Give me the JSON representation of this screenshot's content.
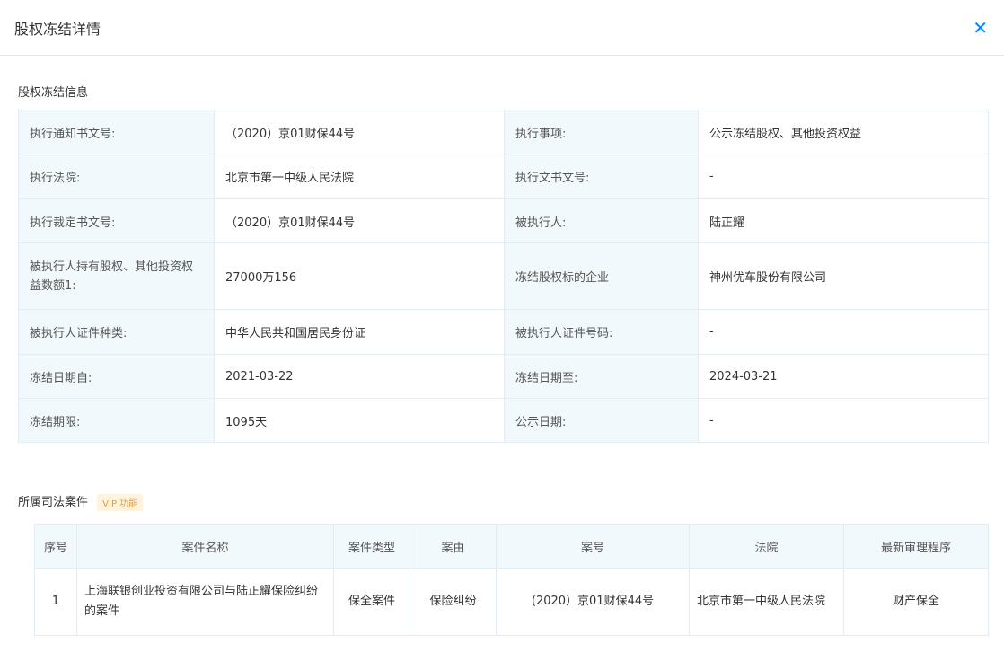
{
  "dialog": {
    "title": "股权冻结详情"
  },
  "info_section": {
    "title": "股权冻结信息",
    "rows": [
      {
        "l1": "执行通知书文号:",
        "v1": "（2020）京01财保44号",
        "l2": "执行事项:",
        "v2": "公示冻结股权、其他投资权益"
      },
      {
        "l1": "执行法院:",
        "v1": "北京市第一中级人民法院",
        "l2": "执行文书文号:",
        "v2": "-"
      },
      {
        "l1": "执行裁定书文号:",
        "v1": "（2020）京01财保44号",
        "l2": "被执行人:",
        "v2": "陆正耀"
      },
      {
        "l1": "被执行人持有股权、其他投资权益数额1:",
        "v1": "27000万156",
        "l2": "冻结股权标的企业",
        "v2": "神州优车股份有限公司"
      },
      {
        "l1": "被执行人证件种类:",
        "v1": "中华人民共和国居民身份证",
        "l2": "被执行人证件号码:",
        "v2": "-"
      },
      {
        "l1": "冻结日期自:",
        "v1": "2021-03-22",
        "l2": "冻结日期至:",
        "v2": "2024-03-21"
      },
      {
        "l1": "冻结期限:",
        "v1": "1095天",
        "l2": "公示日期:",
        "v2": "-"
      }
    ]
  },
  "case_section": {
    "title": "所属司法案件",
    "vip_badge": "VIP 功能",
    "columns": [
      "序号",
      "案件名称",
      "案件类型",
      "案由",
      "案号",
      "法院",
      "最新审理程序"
    ],
    "rows": [
      {
        "index": "1",
        "name": "上海联银创业投资有限公司与陆正耀保险纠纷的案件",
        "type": "保全案件",
        "cause": "保险纠纷",
        "case_no": "(2020）京01财保44号",
        "court": "北京市第一中级人民法院",
        "procedure": "财产保全"
      }
    ]
  }
}
